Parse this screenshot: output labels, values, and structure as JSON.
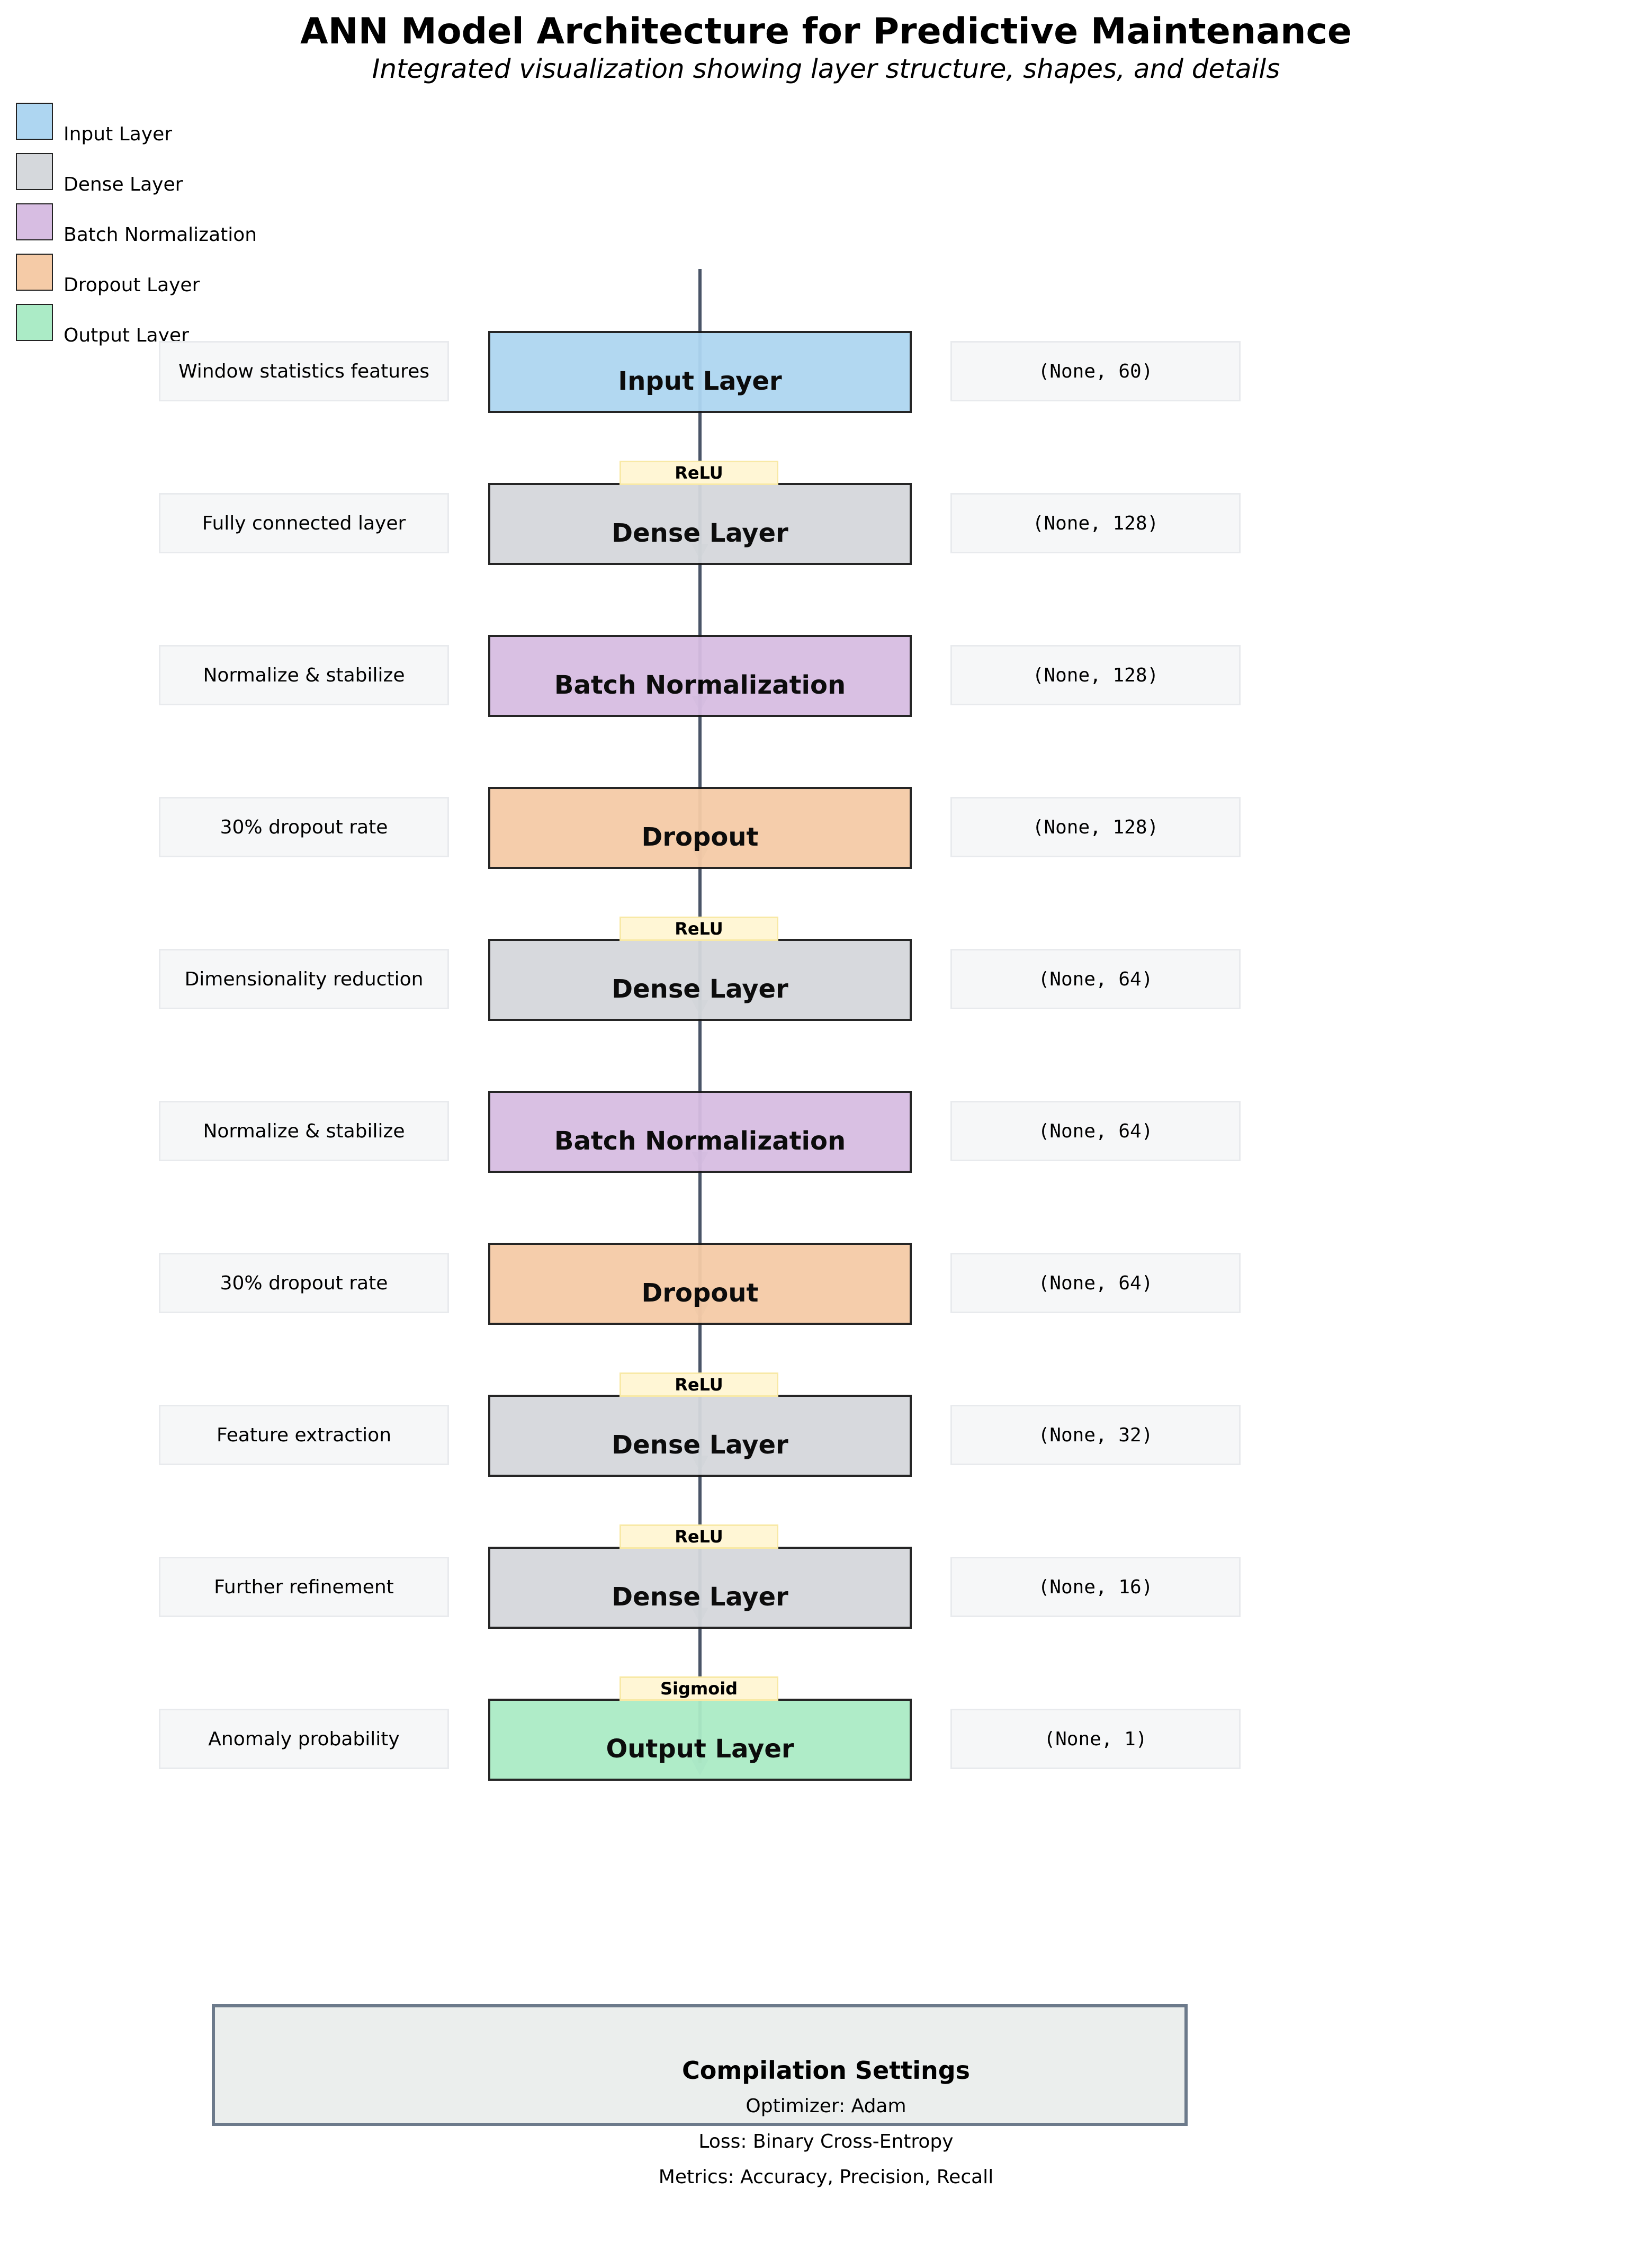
{
  "header": {
    "title": "ANN Model Architecture for Predictive Maintenance",
    "subtitle": "Integrated visualization showing layer structure, shapes, and details"
  },
  "legend": [
    {
      "label": "Input Layer",
      "color": "#aed6f1"
    },
    {
      "label": "Dense Layer",
      "color": "#d5d8dc"
    },
    {
      "label": "Batch Normalization",
      "color": "#d7bde2"
    },
    {
      "label": "Dropout Layer",
      "color": "#f5cba7"
    },
    {
      "label": "Output Layer",
      "color": "#abebc6"
    }
  ],
  "layers": [
    {
      "name": "Input Layer",
      "type": "input",
      "description": "Window statistics features",
      "shape": "(None, 60)",
      "activation": ""
    },
    {
      "name": "Dense Layer",
      "type": "dense",
      "description": "Fully connected layer",
      "shape": "(None, 128)",
      "activation": "ReLU"
    },
    {
      "name": "Batch Normalization",
      "type": "batchnorm",
      "description": "Normalize & stabilize",
      "shape": "(None, 128)",
      "activation": ""
    },
    {
      "name": "Dropout",
      "type": "dropout",
      "description": "30% dropout rate",
      "shape": "(None, 128)",
      "activation": ""
    },
    {
      "name": "Dense Layer",
      "type": "dense",
      "description": "Dimensionality reduction",
      "shape": "(None, 64)",
      "activation": "ReLU"
    },
    {
      "name": "Batch Normalization",
      "type": "batchnorm",
      "description": "Normalize & stabilize",
      "shape": "(None, 64)",
      "activation": ""
    },
    {
      "name": "Dropout",
      "type": "dropout",
      "description": "30% dropout rate",
      "shape": "(None, 64)",
      "activation": ""
    },
    {
      "name": "Dense Layer",
      "type": "dense",
      "description": "Feature extraction",
      "shape": "(None, 32)",
      "activation": "ReLU"
    },
    {
      "name": "Dense Layer",
      "type": "dense",
      "description": "Further refinement",
      "shape": "(None, 16)",
      "activation": "ReLU"
    },
    {
      "name": "Output Layer",
      "type": "output",
      "description": "Anomaly probability",
      "shape": "(None, 1)",
      "activation": "Sigmoid"
    }
  ],
  "compilation": {
    "title": "Compilation Settings",
    "optimizer": "Optimizer: Adam",
    "loss": "Loss: Binary Cross-Entropy",
    "metrics": "Metrics: Accuracy, Precision, Recall"
  },
  "colors": {
    "input": "#aed6f1",
    "dense": "#d5d8dc",
    "batchnorm": "#d7bde2",
    "dropout": "#f5cba7",
    "output": "#abebc6",
    "connector": "#4a5568",
    "activation_bg": "#fff6d5"
  }
}
